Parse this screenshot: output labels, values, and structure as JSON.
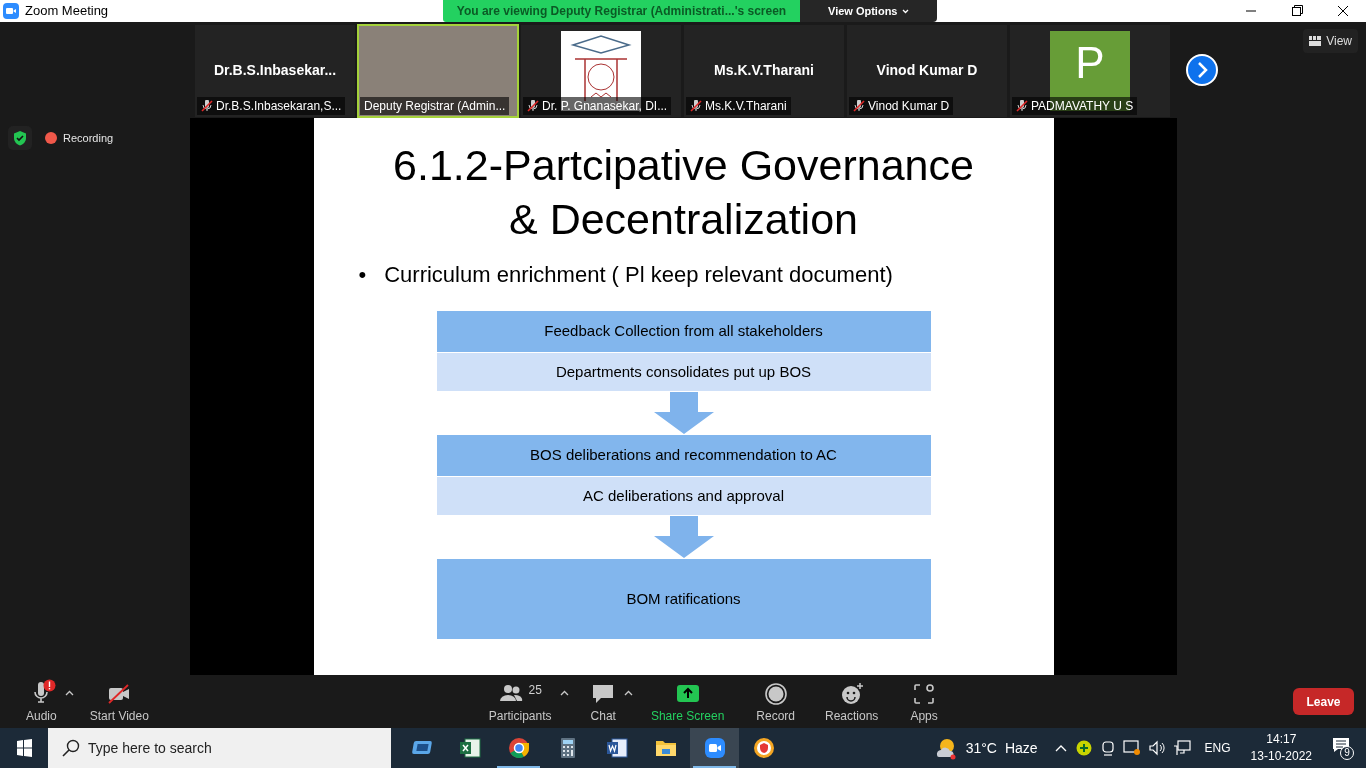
{
  "window": {
    "title": "Zoom Meeting"
  },
  "share_banner": {
    "text": "You are viewing Deputy Registrar (Administrati...'s screen",
    "view_options": "View Options"
  },
  "view_button": "View",
  "tiles": [
    {
      "kind": "name",
      "display_name": "Dr.B.S.Inbasekar...",
      "label": "Dr.B.S.Inbasekaran,S...",
      "muted": true,
      "speaking": false
    },
    {
      "kind": "video",
      "label": "Deputy Registrar (Admin...",
      "muted": false,
      "speaking": true
    },
    {
      "kind": "logo",
      "label": "Dr. P. Gnanasekar, DI...",
      "muted": true,
      "speaking": false
    },
    {
      "kind": "name",
      "display_name": "Ms.K.V.Tharani",
      "label": "Ms.K.V.Tharani",
      "muted": true,
      "speaking": false
    },
    {
      "kind": "name",
      "display_name": "Vinod Kumar D",
      "label": "Vinod Kumar D",
      "muted": true,
      "speaking": false
    },
    {
      "kind": "avatar",
      "initial": "P",
      "label": "PADMAVATHY U S",
      "muted": true,
      "speaking": false
    }
  ],
  "recording": {
    "label": "Recording"
  },
  "slide": {
    "title": "6.1.2-Partcipative Governance & Decentralization",
    "bullet": "•",
    "bullet_text": "Curriculum enrichment ( Pl keep relevant document)",
    "flow": [
      {
        "steps": [
          {
            "kind": "header",
            "text": "Feedback Collection from all stakeholders"
          },
          {
            "kind": "sub",
            "text": "Departments consolidates put up BOS"
          }
        ]
      },
      {
        "steps": [
          {
            "kind": "header",
            "text": "BOS deliberations and recommendation to AC"
          },
          {
            "kind": "sub",
            "text": "AC deliberations and approval"
          }
        ]
      },
      {
        "steps": [
          {
            "kind": "large",
            "text": "BOM ratifications"
          }
        ]
      }
    ]
  },
  "toolbar": [
    {
      "kind": "audio",
      "label": "Audio",
      "caret": true,
      "alert": true
    },
    {
      "kind": "video",
      "label": "Start Video",
      "caret": false,
      "alert": false
    },
    {
      "kind": "participants",
      "label": "Participants",
      "count": "25",
      "caret": true,
      "alert": false
    },
    {
      "kind": "chat",
      "label": "Chat",
      "caret": true,
      "alert": false
    },
    {
      "kind": "share",
      "label": "Share Screen",
      "caret": false,
      "alert": false
    },
    {
      "kind": "record",
      "label": "Record",
      "caret": false,
      "alert": false
    },
    {
      "kind": "reactions",
      "label": "Reactions",
      "caret": false,
      "alert": false
    },
    {
      "kind": "apps",
      "label": "Apps",
      "caret": false,
      "alert": false
    }
  ],
  "leave": "Leave",
  "taskbar": {
    "search_placeholder": "Type here to search",
    "apps": [
      {
        "kind": "monitor",
        "running": false,
        "active": false
      },
      {
        "kind": "spreadsheet",
        "running": false,
        "active": false
      },
      {
        "kind": "browser",
        "running": true,
        "active": false
      },
      {
        "kind": "calculator",
        "running": false,
        "active": false
      },
      {
        "kind": "document",
        "running": false,
        "active": false
      },
      {
        "kind": "folder",
        "running": false,
        "active": false
      },
      {
        "kind": "camera",
        "running": true,
        "active": true
      },
      {
        "kind": "shield",
        "running": false,
        "active": false
      }
    ],
    "weather": {
      "temp": "31°C",
      "condition": "Haze"
    },
    "language": "ENG",
    "time": "14:17",
    "date": "13-10-2022",
    "notifications": "9"
  }
}
